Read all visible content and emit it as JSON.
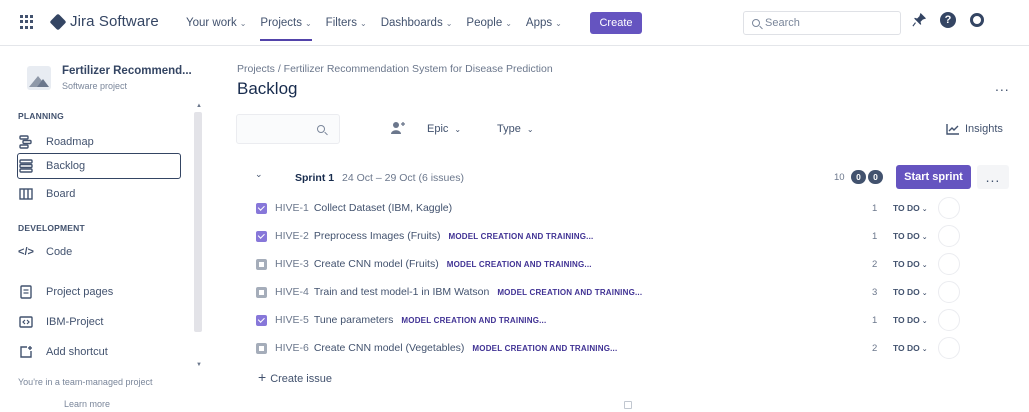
{
  "topnav": {
    "brand": "Jira Software",
    "items": [
      {
        "label": "Your work",
        "active": false
      },
      {
        "label": "Projects",
        "active": true
      },
      {
        "label": "Filters",
        "active": false
      },
      {
        "label": "Dashboards",
        "active": false
      },
      {
        "label": "People",
        "active": false
      },
      {
        "label": "Apps",
        "active": false
      }
    ],
    "create_label": "Create",
    "search_placeholder": "Search",
    "help_glyph": "?"
  },
  "sidebar": {
    "project_name": "Fertilizer Recommend...",
    "project_type": "Software project",
    "planning_label": "PLANNING",
    "development_label": "DEVELOPMENT",
    "items": {
      "roadmap": "Roadmap",
      "backlog": "Backlog",
      "board": "Board",
      "code": "Code",
      "project_pages": "Project pages",
      "ibm_project": "IBM-Project",
      "add_shortcut": "Add shortcut"
    },
    "footer_text": "You're in a team-managed project",
    "learn_more": "Learn more"
  },
  "main": {
    "breadcrumb": "Projects / Fertilizer Recommendation System for Disease Prediction",
    "title": "Backlog",
    "more_glyph": "...",
    "filters": {
      "epic": "Epic",
      "type": "Type"
    },
    "insights": "Insights"
  },
  "sprint": {
    "toggle_glyph": "⌄",
    "name": "Sprint 1",
    "dates": "24 Oct – 29 Oct (6 issues)",
    "count": "10",
    "pill_a": "0",
    "pill_b": "0",
    "start_label": "Start sprint",
    "more_glyph": "...",
    "issues": [
      {
        "key": "HIVE-1",
        "summary": "Collect Dataset (IBM, Kaggle)",
        "epic": "",
        "points": "1",
        "status": "TO DO",
        "type": "done"
      },
      {
        "key": "HIVE-2",
        "summary": "Preprocess Images (Fruits)",
        "epic": "MODEL CREATION AND TRAINING...",
        "points": "1",
        "status": "TO DO",
        "type": "done"
      },
      {
        "key": "HIVE-3",
        "summary": "Create CNN model (Fruits)",
        "epic": "MODEL CREATION AND TRAINING...",
        "points": "2",
        "status": "TO DO",
        "type": "open"
      },
      {
        "key": "HIVE-4",
        "summary": "Train and test model-1 in IBM Watson",
        "epic": "MODEL CREATION AND TRAINING...",
        "points": "3",
        "status": "TO DO",
        "type": "open"
      },
      {
        "key": "HIVE-5",
        "summary": "Tune parameters",
        "epic": "MODEL CREATION AND TRAINING...",
        "points": "1",
        "status": "TO DO",
        "type": "done"
      },
      {
        "key": "HIVE-6",
        "summary": "Create CNN model (Vegetables)",
        "epic": "MODEL CREATION AND TRAINING...",
        "points": "2",
        "status": "TO DO",
        "type": "open"
      }
    ],
    "create_issue": "Create issue"
  },
  "colors": {
    "accent": "#6554c0",
    "text": "#42526e",
    "epic": "#403294"
  }
}
